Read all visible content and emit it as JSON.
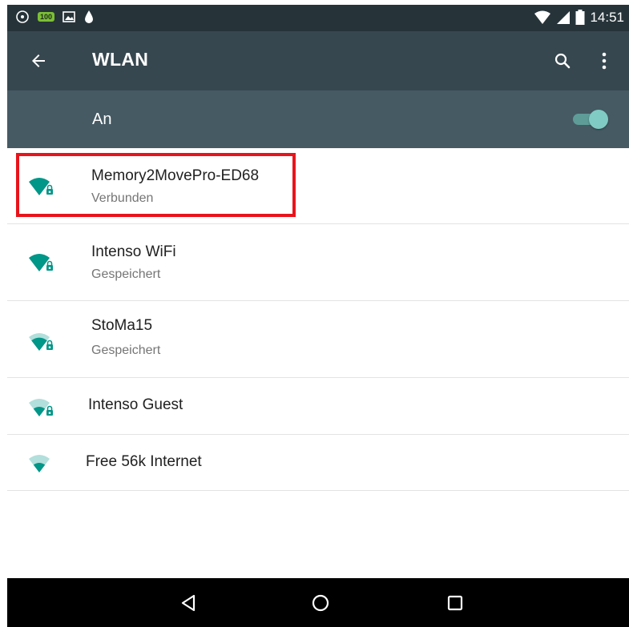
{
  "status_bar": {
    "time": "14:51",
    "battery_badge": "100",
    "icons": [
      "shield-icon",
      "battery-saver-icon",
      "image-icon",
      "drop-icon",
      "wifi-signal-icon",
      "cell-signal-icon",
      "battery-icon"
    ]
  },
  "app_bar": {
    "title": "WLAN",
    "icons": [
      "back-arrow-icon",
      "search-icon",
      "overflow-menu-icon"
    ]
  },
  "master_switch": {
    "label": "An",
    "state": "on"
  },
  "networks": [
    {
      "ssid": "Memory2MovePro-ED68",
      "status": "Verbunden",
      "signal_level": 4,
      "secured": true,
      "highlighted": true
    },
    {
      "ssid": "Intenso WiFi",
      "status": "Gespeichert",
      "signal_level": 4,
      "secured": true
    },
    {
      "ssid": "StoMa15",
      "status": "Gespeichert",
      "signal_level": 3,
      "secured": true
    },
    {
      "ssid": "Intenso Guest",
      "signal_level": 2,
      "secured": true
    },
    {
      "ssid": "Free 56k Internet",
      "signal_level": 2,
      "secured": false
    }
  ],
  "nav_bar": {
    "icons": [
      "nav-back-icon",
      "nav-home-icon",
      "nav-recents-icon"
    ]
  },
  "colors": {
    "status_bar": "#26343a",
    "app_bar": "#37474f",
    "switch_bar": "#465a64",
    "accent": "#009688",
    "accent_dim": "#80cbc4",
    "highlight": "#e8141b"
  }
}
